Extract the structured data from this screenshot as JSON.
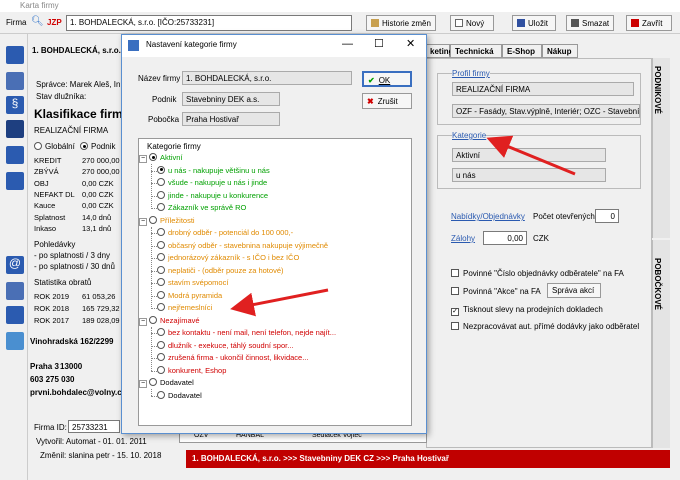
{
  "window": {
    "title": "Karta firmy"
  },
  "toolbar": {
    "firma_label": "Firma",
    "jzp_label": "JZP",
    "company_field": "1. BOHDALECKÁ, s.r.o.    [IČO:25733231]",
    "buttons": [
      "Historie změn",
      "Nový",
      "Uložit",
      "Smazat",
      "Zavřít"
    ]
  },
  "main": {
    "company_header": "1. BOHDALECKÁ, s.r.o.",
    "spravce": "Správce: Marek Aleš, In",
    "stav": "Stav dlužníka:",
    "klasifikace_title": "Klasifikace firm",
    "radio_globalni": "Globální",
    "radio_podnik": "Podnik",
    "realizacni_firma": "REALIZAČNÍ FIRMA",
    "finance": [
      {
        "label": "KREDIT",
        "value": "270 000,00"
      },
      {
        "label": "ZBÝVÁ",
        "value": "270 000,00"
      },
      {
        "label": "OBJ",
        "value": "0,00 CZK"
      },
      {
        "label": "NEFAKT DL",
        "value": "0,00 CZK"
      },
      {
        "label": "Kauce",
        "value": "0,00 CZK"
      },
      {
        "label": "Splatnost",
        "value": "14,0 dnů"
      },
      {
        "label": "Inkaso",
        "value": "13,1 dnů"
      }
    ],
    "pohledavky_title": "Pohledávky",
    "pohledavky": [
      "- po splatnosti / 3 dny",
      "- po splatnosti / 30 dnů"
    ],
    "statistika_title": "Statistika obratů",
    "statistika": [
      {
        "label": "ROK 2019",
        "value": "61 053,26"
      },
      {
        "label": "ROK 2018",
        "value": "165 729,32"
      },
      {
        "label": "ROK 2017",
        "value": "189 028,09"
      }
    ],
    "address_street": "Vinohradská 162/2299",
    "address_city": "Praha 3",
    "address_zip": "13000",
    "phone": "603 275 030",
    "email": "prvni.bohdalec@volny.c",
    "firma_id_label": "Firma ID:",
    "firma_id": "25733231",
    "vytvoril": "Vytvořil: Automat - 01. 01. 2011",
    "zmenil": "Změnil: slanina petr - 15. 10. 2018"
  },
  "tabs": [
    "keting",
    "Technická",
    "E-Shop",
    "Nákup"
  ],
  "right_panel": {
    "profil_link": "Profil firmy",
    "profil_value": "REALIZAČNÍ FIRMA",
    "profil_desc": "OZF - Fasády, Stav.výplně, Interiér; OZC - Stavební fi",
    "kategorie_link": "Kategorie",
    "kategorie_value1": "Aktivní",
    "kategorie_value2": "u nás",
    "nabidky_link": "Nabídky/Objednávky",
    "pocet_label": "Počet otevřených",
    "pocet_value": "0",
    "zalohy_link": "Zálohy",
    "zalohy_value": "0,00",
    "zalohy_currency": "CZK",
    "check1": "Povinné \"Číslo objednávky odběratele\" na FA",
    "check2": "Povinná \"Akce\" na FA",
    "sprava_akci": "Správa akcí",
    "check3": "Tisknout slevy na prodejních dokladech",
    "check4": "Nezpracovávat aut. přímé dodávky jako odběratel",
    "vtab_top": "PODNIKOVÉ",
    "vtab_bottom": "POBOČKOVÉ",
    "table_row": [
      "OZV",
      "HANBAL",
      "Sedláček Vojtěc"
    ]
  },
  "status_bar": "1. BOHDALECKÁ, s.r.o. >>> Stavebniny DEK CZ >>> Praha Hostivař",
  "dialog": {
    "title": "Nastavení kategorie firmy",
    "nazev_label": "Název firmy",
    "nazev_value": "1. BOHDALECKÁ, s.r.o.",
    "podnik_label": "Podnik",
    "podnik_value": "Stavebniny DEK a.s.",
    "pobocka_label": "Pobočka",
    "pobocka_value": "Praha Hostivař",
    "ok": "OK",
    "zrusit": "Zrušit",
    "tree_title": "Kategorie firmy",
    "groups": [
      {
        "label": "Aktivní",
        "color": "green",
        "items": [
          "u nás - nakupuje většinu u nás",
          "všude - nakupuje u nás i jinde",
          "jinde - nakupuje u konkurence",
          "Zákazník ve správě RO"
        ]
      },
      {
        "label": "Příležitosti",
        "color": "orange",
        "items": [
          "drobný odběr - potenciál do 100 000,-",
          "občasný odběr - stavebnina nakupuje výjimečně",
          "jednorázový zákazník - s IČO i bez IČO",
          "neplatiči - (odběr pouze za hotové)",
          "stavím svépomocí",
          "Modrá pyramida",
          "nejřemeslníci"
        ]
      },
      {
        "label": "Nezajímavé",
        "color": "red",
        "items": [
          "bez kontaktu - není mail, není telefon, nejde najít...",
          "dlužník - exekuce, táhlý soudní spor...",
          "zrušená firma - ukončil činnost, likvidace...",
          "konkurent, Eshop"
        ]
      },
      {
        "label": "Dodavatel",
        "color": "black",
        "items": [
          "Dodavatel"
        ]
      }
    ]
  },
  "colors": {
    "accent_red": "#d00000",
    "status_red": "#c00000",
    "green": "#00a000",
    "orange": "#e08a00"
  }
}
